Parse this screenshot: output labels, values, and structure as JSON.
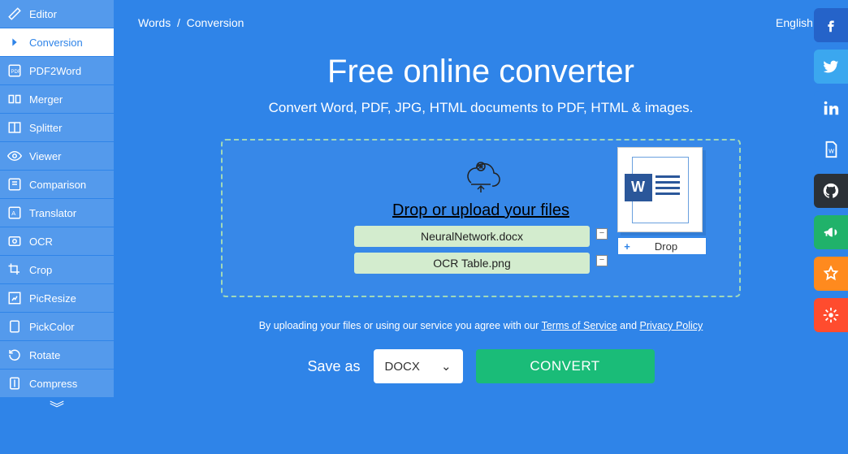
{
  "sidebar": {
    "items": [
      {
        "label": "Editor",
        "icon": "editor"
      },
      {
        "label": "Conversion",
        "icon": "conversion"
      },
      {
        "label": "PDF2Word",
        "icon": "pdf"
      },
      {
        "label": "Merger",
        "icon": "merger"
      },
      {
        "label": "Splitter",
        "icon": "splitter"
      },
      {
        "label": "Viewer",
        "icon": "eye"
      },
      {
        "label": "Comparison",
        "icon": "compare"
      },
      {
        "label": "Translator",
        "icon": "translate"
      },
      {
        "label": "OCR",
        "icon": "ocr"
      },
      {
        "label": "Crop",
        "icon": "crop"
      },
      {
        "label": "PicResize",
        "icon": "resize"
      },
      {
        "label": "PickColor",
        "icon": "picker"
      },
      {
        "label": "Rotate",
        "icon": "rotate"
      },
      {
        "label": "Compress",
        "icon": "compress"
      }
    ],
    "active_index": 1
  },
  "breadcrumb": {
    "root": "Words",
    "current": "Conversion"
  },
  "language": "English",
  "hero": {
    "title": "Free online converter",
    "subtitle": "Convert Word, PDF, JPG, HTML documents to PDF, HTML & images."
  },
  "dropzone": {
    "label": "Drop or upload your files",
    "files": [
      "NeuralNetwork.docx",
      "OCR Table.png"
    ],
    "hint": "Drop"
  },
  "terms": {
    "prefix": "By uploading your files or using our service you agree with our ",
    "tos": "Terms of Service",
    "mid": " and ",
    "privacy": "Privacy Policy"
  },
  "action": {
    "save_as": "Save as",
    "format": "DOCX",
    "convert": "CONVERT"
  }
}
